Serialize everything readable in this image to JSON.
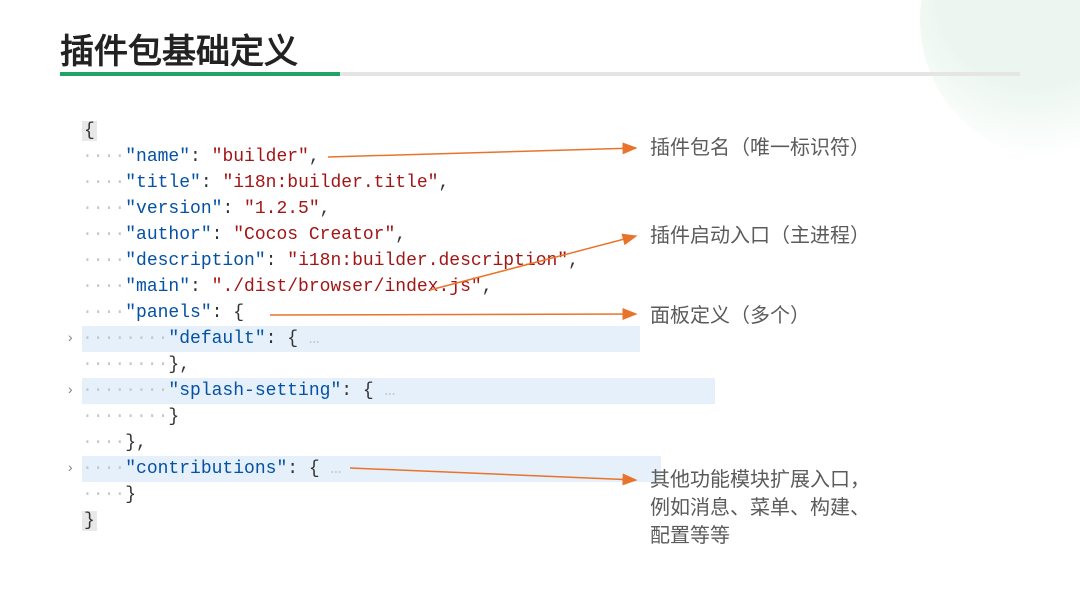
{
  "title": "插件包基础定义",
  "code": {
    "open_brace": "{",
    "name_key": "\"name\"",
    "name_val": "\"builder\"",
    "title_key": "\"title\"",
    "title_val": "\"i18n:builder.title\"",
    "version_key": "\"version\"",
    "version_val": "\"1.2.5\"",
    "author_key": "\"author\"",
    "author_val": "\"Cocos Creator\"",
    "desc_key": "\"description\"",
    "desc_val": "\"i18n:builder.description\"",
    "main_key": "\"main\"",
    "main_val": "\"./dist/browser/index.js\"",
    "panels_key": "\"panels\"",
    "default_key": "\"default\"",
    "splash_key": "\"splash-setting\"",
    "contrib_key": "\"contributions\"",
    "ellipsis": "…",
    "close_brace": "}",
    "close_brace_comma": "},",
    "open_obj": ": {",
    "colon_space": ": "
  },
  "annotations": {
    "a1": "插件包名（唯一标识符）",
    "a2": "插件启动入口（主进程）",
    "a3": "面板定义（多个）",
    "a4": "其他功能模块扩展入口，\n例如消息、菜单、构建、\n配置等等"
  }
}
